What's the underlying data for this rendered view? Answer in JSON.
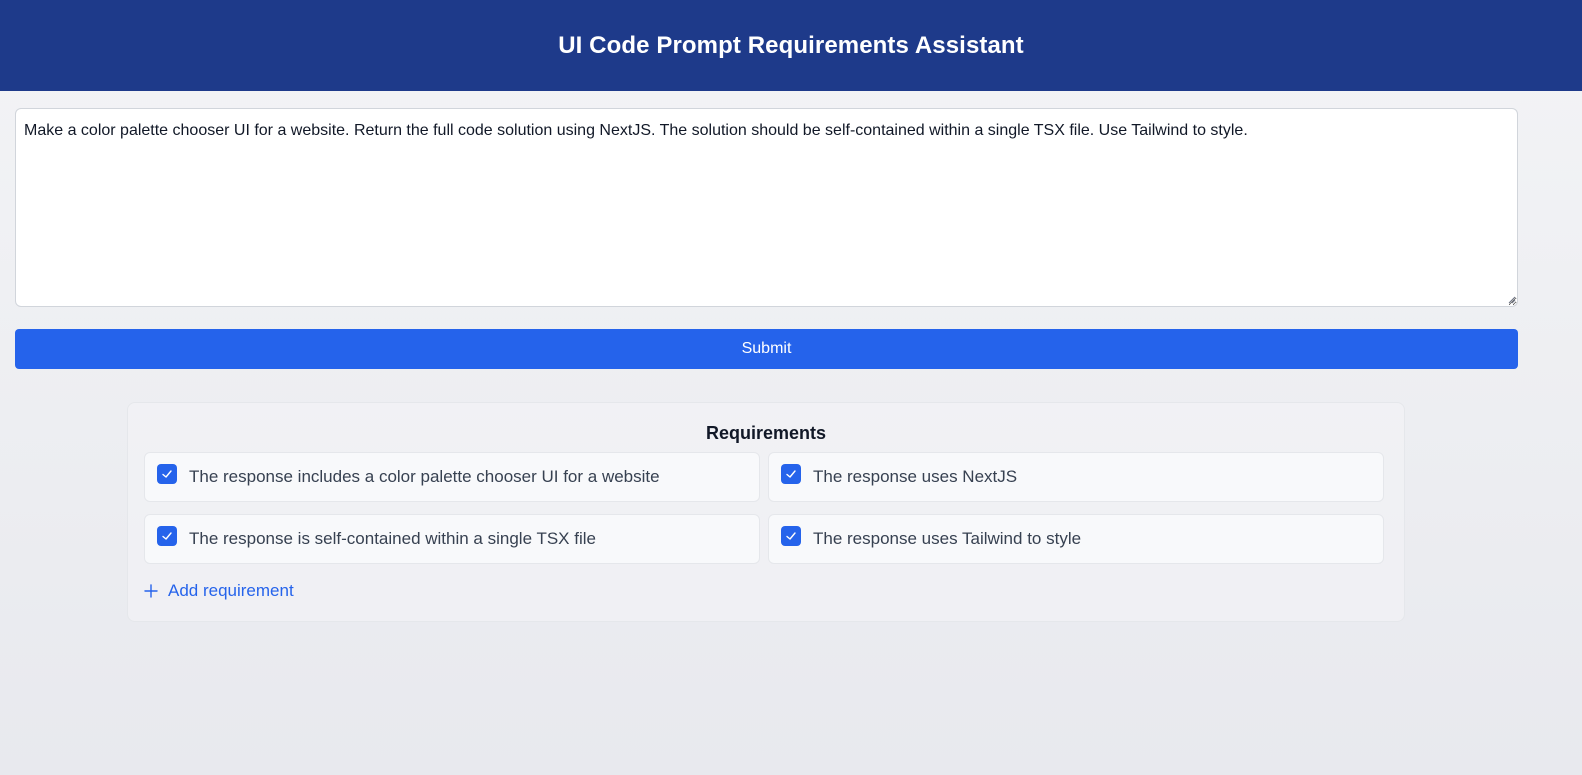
{
  "header": {
    "title": "UI Code Prompt Requirements Assistant"
  },
  "prompt": {
    "value": "Make a color palette chooser UI for a website. Return the full code solution using NextJS. The solution should be self-contained within a single TSX file. Use Tailwind to style."
  },
  "submit": {
    "label": "Submit"
  },
  "requirements": {
    "title": "Requirements",
    "items": [
      {
        "label": "The response includes a color palette chooser UI for a website",
        "checked": true
      },
      {
        "label": "The response uses NextJS",
        "checked": true
      },
      {
        "label": "The response is self-contained within a single TSX file",
        "checked": true
      },
      {
        "label": "The response uses Tailwind to style",
        "checked": true
      }
    ],
    "add_label": "Add requirement"
  },
  "colors": {
    "header_bg": "#1e3a8a",
    "accent": "#2563eb"
  },
  "icons": {
    "checkbox": "check-icon",
    "add": "plus-icon",
    "grip": "resize-grip-icon"
  }
}
